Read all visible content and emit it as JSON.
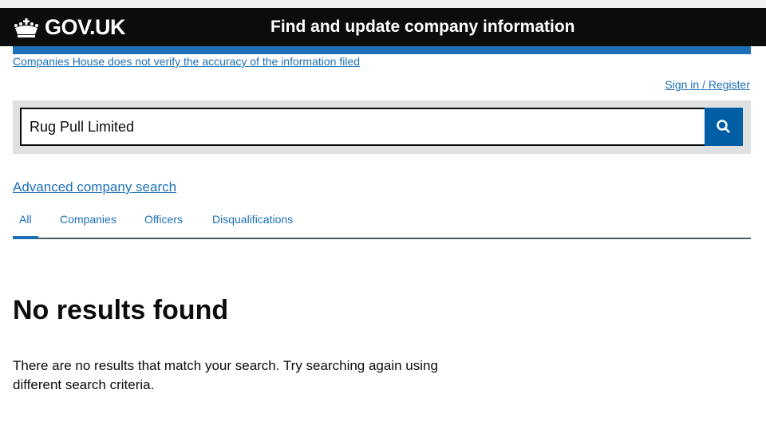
{
  "header": {
    "logo_text": "GOV.UK",
    "service_name": "Find and update company information"
  },
  "disclaimer": "Companies House does not verify the accuracy of the information filed",
  "sign_in": "Sign in / Register",
  "search": {
    "value": "Rug Pull Limited",
    "button_icon": "search-icon"
  },
  "advanced_search": "Advanced company search",
  "tabs": [
    {
      "label": "All",
      "active": true
    },
    {
      "label": "Companies"
    },
    {
      "label": "Officers"
    },
    {
      "label": "Disqualifications"
    }
  ],
  "results": {
    "heading": "No results found",
    "message": "There are no results that match your search. Try searching again using different search criteria."
  },
  "colors": {
    "link": "#1d70b8",
    "header": "#0b0c0c",
    "search_button": "#005ea5"
  }
}
